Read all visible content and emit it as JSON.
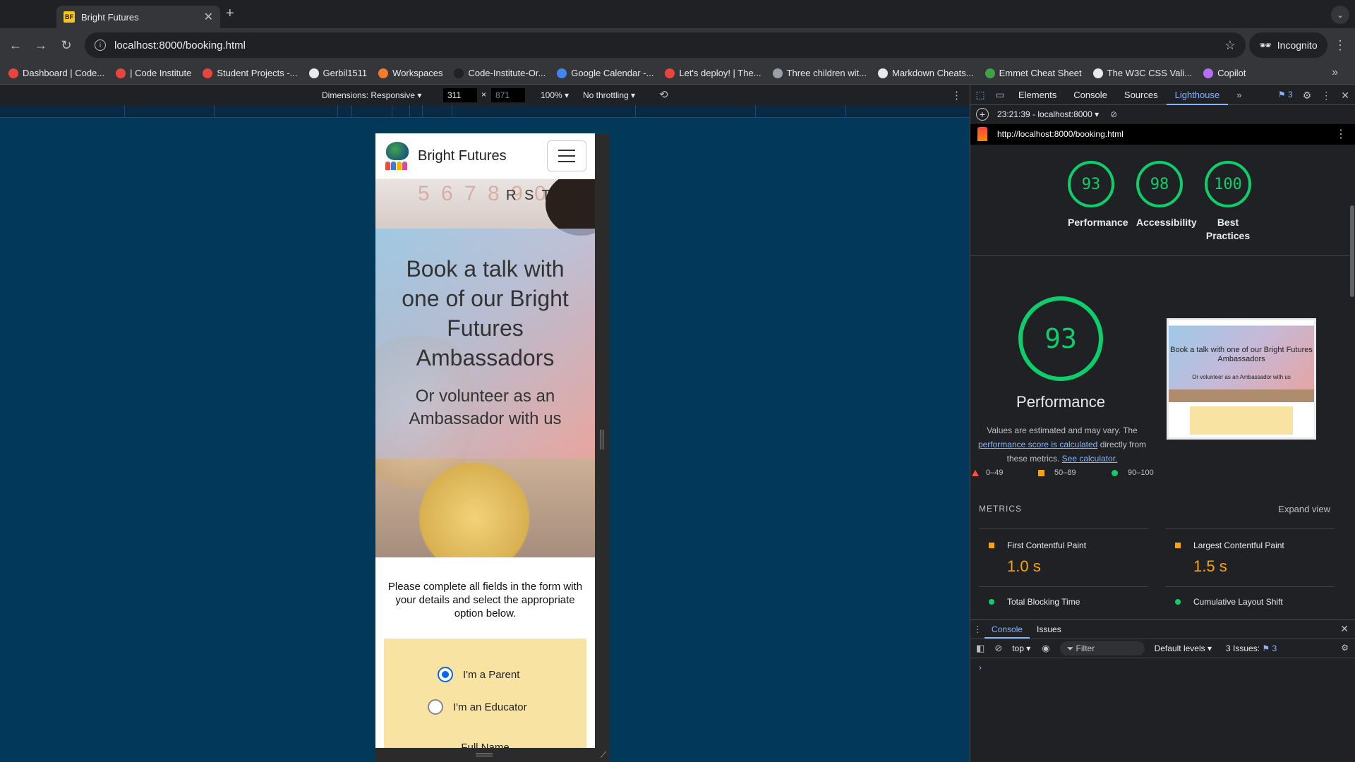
{
  "tab": {
    "favicon_text": "BF",
    "title": "Bright Futures",
    "new_tab": "+"
  },
  "toolbar": {
    "url": "localhost:8000/booking.html",
    "incognito": "Incognito"
  },
  "bookmarks": [
    {
      "label": "Dashboard | Code...",
      "color": "#e8453c"
    },
    {
      "label": "| Code Institute",
      "color": "#e8453c"
    },
    {
      "label": "Student Projects -...",
      "color": "#e8453c"
    },
    {
      "label": "Gerbil1511",
      "color": "#e8eaed"
    },
    {
      "label": "Workspaces",
      "color": "#f57c28"
    },
    {
      "label": "Code-Institute-Or...",
      "color": "#202124"
    },
    {
      "label": "Google Calendar -...",
      "color": "#4285f4"
    },
    {
      "label": "Let's deploy! | The...",
      "color": "#e8453c"
    },
    {
      "label": "Three children wit...",
      "color": "#9aa0a6"
    },
    {
      "label": "Markdown Cheats...",
      "color": "#e8eaed"
    },
    {
      "label": "Emmet Cheat Sheet",
      "color": "#3ea345"
    },
    {
      "label": "The W3C CSS Vali...",
      "color": "#e8eaed"
    },
    {
      "label": "Copilot",
      "color": "#b76ef5"
    }
  ],
  "device_toolbar": {
    "dimensions": "Dimensions: Responsive ▾",
    "width": "311",
    "times": "×",
    "height": "871",
    "zoom": "100% ▾",
    "throttling": "No throttling ▾"
  },
  "site": {
    "brand": "Bright Futures",
    "hero_title": "Book a talk with one of our Bright Futures Ambassadors",
    "hero_subtitle": "Or volunteer as an Ambassador with us",
    "hero_letters": "5 6 7 8 9 0",
    "hero_letters2": "R S T U V",
    "intro": "Please complete all fields in the form with your details and select the appropriate option below.",
    "radio_parent": "I'm a Parent",
    "radio_educator": "I'm an Educator",
    "full_name_label": "Full Name",
    "selected_role": "parent"
  },
  "devtools": {
    "tabs": [
      "Elements",
      "Console",
      "Sources",
      "Lighthouse"
    ],
    "active_tab": "Lighthouse",
    "issue_count": "3",
    "report_time": "23:21:39 - localhost:8000 ▾",
    "report_url": "http://localhost:8000/booking.html",
    "scores": [
      {
        "value": "93",
        "label": "Performance"
      },
      {
        "value": "98",
        "label": "Accessibility"
      },
      {
        "value": "100",
        "label": "Best Practices"
      }
    ],
    "main_score": "93",
    "main_title": "Performance",
    "note_prefix": "Values are estimated and may vary. The",
    "note_link1": "performance score is calculated",
    "note_mid": "directly from these metrics.",
    "note_link2": "See calculator.",
    "thumb_title": "Book a talk with one of our Bright Futures Ambassadors",
    "thumb_sub": "Or volunteer as an Ambassador with us",
    "legend": [
      {
        "label": "0–49",
        "color": "#ff4e42"
      },
      {
        "label": "50–89",
        "color": "#ffa400"
      },
      {
        "label": "90–100",
        "color": "#0cce6b"
      }
    ],
    "metrics_heading": "METRICS",
    "expand_view": "Expand view",
    "metrics": [
      {
        "name": "First Contentful Paint",
        "value": "1.0 s"
      },
      {
        "name": "Largest Contentful Paint",
        "value": "1.5 s"
      },
      {
        "name": "Total Blocking Time",
        "value": ""
      },
      {
        "name": "Cumulative Layout Shift",
        "value": ""
      }
    ],
    "drawer_tabs": [
      "Console",
      "Issues"
    ],
    "console_context": "top ▾",
    "filter_placeholder": "Filter",
    "default_levels": "Default levels ▾",
    "issues_label": "3 Issues:",
    "issues_count": "3",
    "prompt": "›"
  },
  "colors": {
    "good": "#0cce6b",
    "average": "#ffa400",
    "link": "#8ab4f8",
    "viewport_bg": "#023859"
  }
}
